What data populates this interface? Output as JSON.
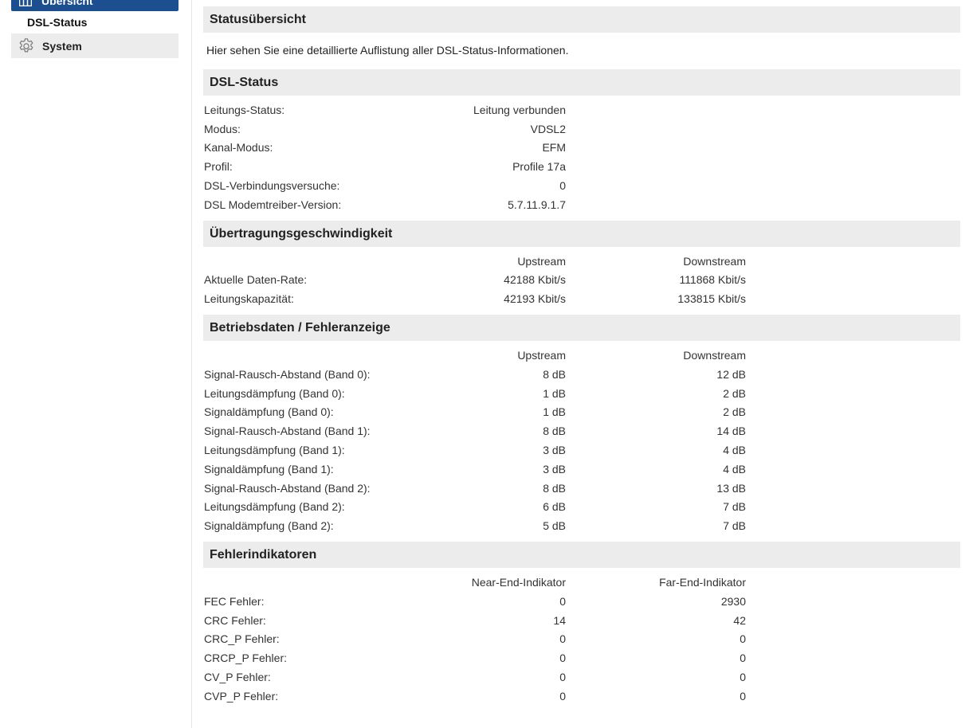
{
  "sidebar": {
    "top_item_label": "Übersicht",
    "sub_item_label": "DSL-Status",
    "system_label": "System"
  },
  "overview": {
    "title": "Statusübersicht",
    "intro": "Hier sehen Sie eine detaillierte Auflistung aller DSL-Status-Informationen."
  },
  "dsl_status": {
    "title": "DSL-Status",
    "rows": [
      {
        "label": "Leitungs-Status:",
        "value": "Leitung verbunden"
      },
      {
        "label": "Modus:",
        "value": "VDSL2"
      },
      {
        "label": "Kanal-Modus:",
        "value": "EFM"
      },
      {
        "label": "Profil:",
        "value": "Profile 17a"
      },
      {
        "label": "DSL-Verbindungsversuche:",
        "value": "0"
      },
      {
        "label": "DSL Modemtreiber-Version:",
        "value": "5.7.11.9.1.7"
      }
    ]
  },
  "speed": {
    "title": "Übertragungsgeschwindigkeit",
    "col1": "Upstream",
    "col2": "Downstream",
    "rows": [
      {
        "label": "Aktuelle Daten-Rate:",
        "up": "42188 Kbit/s",
        "down": "111868 Kbit/s"
      },
      {
        "label": "Leitungskapazität:",
        "up": "42193 Kbit/s",
        "down": "133815 Kbit/s"
      }
    ]
  },
  "operating": {
    "title": "Betriebsdaten / Fehleranzeige",
    "col1": "Upstream",
    "col2": "Downstream",
    "rows": [
      {
        "label": "Signal-Rausch-Abstand (Band 0):",
        "up": "8 dB",
        "down": "12 dB"
      },
      {
        "label": "Leitungsdämpfung (Band 0):",
        "up": "1 dB",
        "down": "2 dB"
      },
      {
        "label": "Signaldämpfung (Band 0):",
        "up": "1 dB",
        "down": "2 dB"
      },
      {
        "label": "Signal-Rausch-Abstand (Band 1):",
        "up": "8 dB",
        "down": "14 dB"
      },
      {
        "label": "Leitungsdämpfung (Band 1):",
        "up": "3 dB",
        "down": "4 dB"
      },
      {
        "label": "Signaldämpfung (Band 1):",
        "up": "3 dB",
        "down": "4 dB"
      },
      {
        "label": "Signal-Rausch-Abstand (Band 2):",
        "up": "8 dB",
        "down": "13 dB"
      },
      {
        "label": "Leitungsdämpfung (Band 2):",
        "up": "6 dB",
        "down": "7 dB"
      },
      {
        "label": "Signaldämpfung (Band 2):",
        "up": "5 dB",
        "down": "7 dB"
      }
    ]
  },
  "errors": {
    "title": "Fehlerindikatoren",
    "col1": "Near-End-Indikator",
    "col2": "Far-End-Indikator",
    "rows": [
      {
        "label": "FEC Fehler:",
        "up": "0",
        "down": "2930"
      },
      {
        "label": "CRC Fehler:",
        "up": "14",
        "down": "42"
      },
      {
        "label": "CRC_P Fehler:",
        "up": "0",
        "down": "0"
      },
      {
        "label": "CRCP_P Fehler:",
        "up": "0",
        "down": "0"
      },
      {
        "label": "CV_P Fehler:",
        "up": "0",
        "down": "0"
      },
      {
        "label": "CVP_P Fehler:",
        "up": "0",
        "down": "0"
      }
    ]
  }
}
